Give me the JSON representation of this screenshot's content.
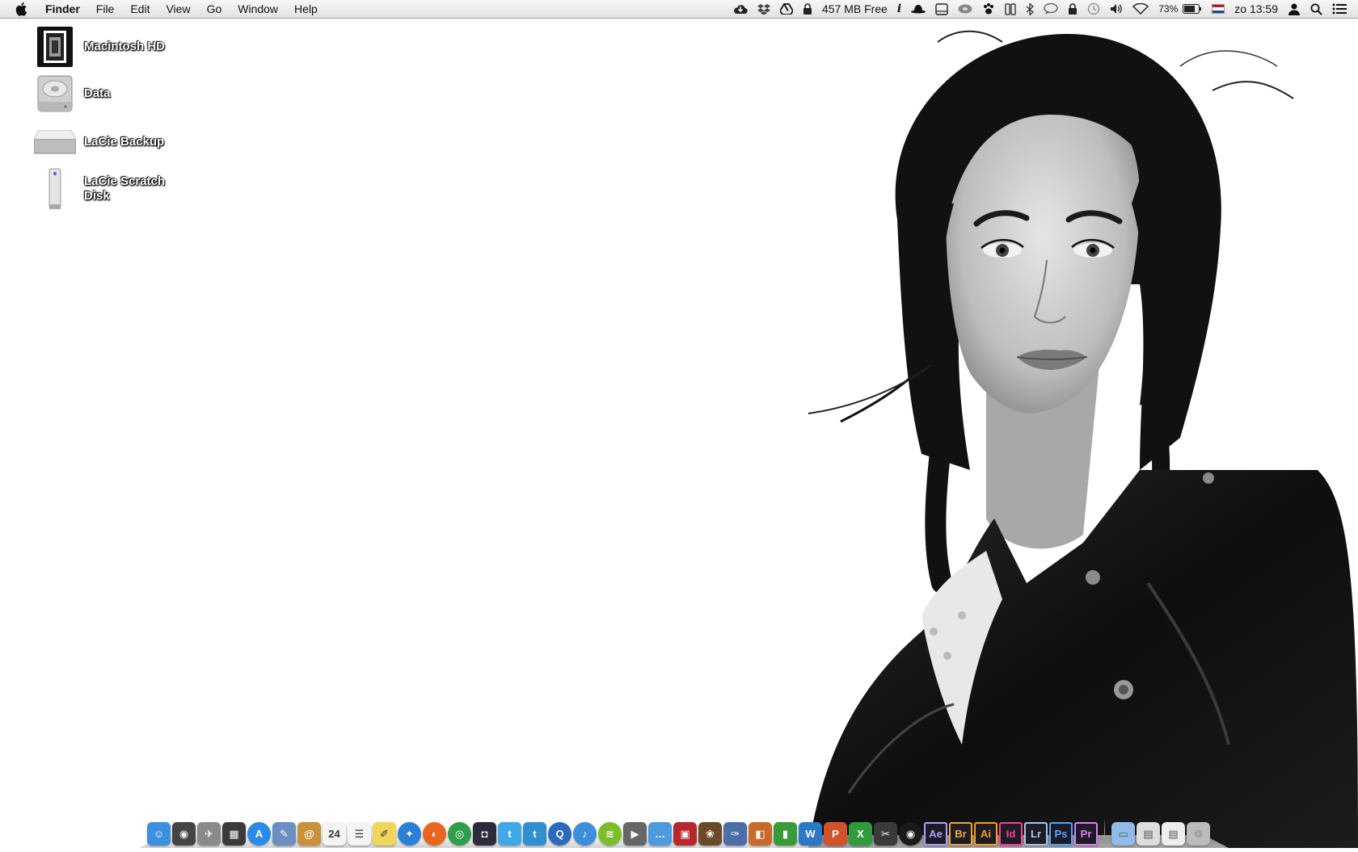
{
  "menubar": {
    "app_name": "Finder",
    "menus": [
      "File",
      "Edit",
      "View",
      "Go",
      "Window",
      "Help"
    ],
    "memory_free": "457 MB Free",
    "battery_percent": "73%",
    "clock": "zo 13:59",
    "status_icons": [
      "cloud-upload-icon",
      "dropbox-icon",
      "google-drive-icon",
      "lock-icon",
      "info-icon",
      "hat-icon",
      "drive-icon",
      "disc-icon",
      "paw-icon",
      "split-view-icon",
      "bluetooth-icon",
      "chat-bubble-icon",
      "padlock-icon",
      "time-machine-icon",
      "volume-icon",
      "wifi-icon",
      "battery-icon",
      "flag-nl-icon",
      "user-icon",
      "spotlight-icon",
      "notification-center-icon"
    ],
    "flag_colors": [
      "#ae1c28",
      "#ffffff",
      "#21468b"
    ]
  },
  "desktop": {
    "items": [
      {
        "label": "Macintosh HD",
        "icon": "boot-drive-icon"
      },
      {
        "label": "Data",
        "icon": "hard-drive-icon"
      },
      {
        "label": "LaCie Backup",
        "icon": "external-drive-icon"
      },
      {
        "label": "LaCie Scratch Disk",
        "icon": "tower-drive-icon"
      }
    ]
  },
  "dock": {
    "apps": [
      {
        "name": "finder",
        "glyph": "☺",
        "color": "#3d8fe0"
      },
      {
        "name": "dashboard",
        "glyph": "◉",
        "color": "#444444"
      },
      {
        "name": "launchpad",
        "glyph": "✈",
        "color": "#8a8a8a"
      },
      {
        "name": "mission-control",
        "glyph": "▦",
        "color": "#3a3a3a"
      },
      {
        "name": "app-store",
        "glyph": "A",
        "color": "#2a8ae8"
      },
      {
        "name": "preview",
        "glyph": "✎",
        "color": "#6a8fc0"
      },
      {
        "name": "contacts",
        "glyph": "@",
        "color": "#c8913a"
      },
      {
        "name": "calendar",
        "glyph": "24",
        "color": "#f4f4f4"
      },
      {
        "name": "reminders",
        "glyph": "☰",
        "color": "#f4f4f4"
      },
      {
        "name": "notes",
        "glyph": "✐",
        "color": "#f1d55a"
      },
      {
        "name": "safari",
        "glyph": "✦",
        "color": "#2c7fd6"
      },
      {
        "name": "firefox",
        "glyph": "◐",
        "color": "#e8661e"
      },
      {
        "name": "chrome",
        "glyph": "◎",
        "color": "#2f9e4c"
      },
      {
        "name": "photo-booth",
        "glyph": "◘",
        "color": "#2b2b3a"
      },
      {
        "name": "twitter",
        "glyph": "t",
        "color": "#3fa9e6"
      },
      {
        "name": "tweetbot",
        "glyph": "t",
        "color": "#2f8fd1"
      },
      {
        "name": "quicktime",
        "glyph": "Q",
        "color": "#2a6bbf"
      },
      {
        "name": "itunes",
        "glyph": "♪",
        "color": "#3c8fdc"
      },
      {
        "name": "spotify",
        "glyph": "≋",
        "color": "#7dbd2a"
      },
      {
        "name": "facetime",
        "glyph": "▶",
        "color": "#666666"
      },
      {
        "name": "messages",
        "glyph": "…",
        "color": "#4a9be0"
      },
      {
        "name": "photo-book",
        "glyph": "▣",
        "color": "#b5282e"
      },
      {
        "name": "iphoto",
        "glyph": "❀",
        "color": "#6b4a2a"
      },
      {
        "name": "pixelmator",
        "glyph": "✑",
        "color": "#4b6ea8"
      },
      {
        "name": "keynote",
        "glyph": "◧",
        "color": "#c86a2a"
      },
      {
        "name": "numbers",
        "glyph": "▮",
        "color": "#3a9a3a"
      },
      {
        "name": "word",
        "glyph": "W",
        "color": "#2b78c8"
      },
      {
        "name": "powerpoint",
        "glyph": "P",
        "color": "#d2522a"
      },
      {
        "name": "excel",
        "glyph": "X",
        "color": "#2f9b3a"
      },
      {
        "name": "final-cut",
        "glyph": "✂",
        "color": "#3a3a3a"
      },
      {
        "name": "aperture",
        "glyph": "◉",
        "color": "#1a1a1a"
      }
    ],
    "adobe_apps": [
      {
        "name": "after-effects",
        "label": "Ae",
        "color": "#b59cff"
      },
      {
        "name": "bridge",
        "label": "Br",
        "color": "#f0a830"
      },
      {
        "name": "illustrator",
        "label": "Ai",
        "color": "#f7a21b"
      },
      {
        "name": "indesign",
        "label": "Id",
        "color": "#ff3d9a"
      },
      {
        "name": "lightroom",
        "label": "Lr",
        "color": "#a9c6e8"
      },
      {
        "name": "photoshop",
        "label": "Ps",
        "color": "#4fa8ff"
      },
      {
        "name": "premiere",
        "label": "Pr",
        "color": "#e07cff"
      }
    ],
    "right_items": [
      {
        "name": "downloads-folder",
        "glyph": "▭",
        "color": "#8fbde8"
      },
      {
        "name": "recent-photo-stack",
        "glyph": "▤",
        "color": "#dddddd"
      },
      {
        "name": "document-stack",
        "glyph": "▤",
        "color": "#eeeeee"
      },
      {
        "name": "trash",
        "glyph": "♲",
        "color": "#bbbbbb"
      }
    ]
  }
}
